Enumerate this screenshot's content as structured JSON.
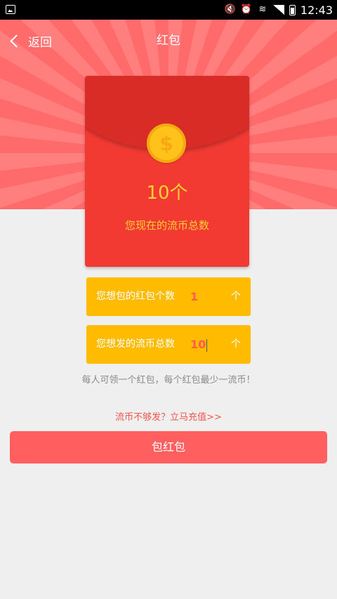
{
  "status_bar": {
    "time": "12:43",
    "icons": [
      "image-icon",
      "mute-icon",
      "alarm-icon",
      "wifi-icon",
      "signal-icon",
      "battery-icon"
    ]
  },
  "nav": {
    "back_label": "返回",
    "title": "红包"
  },
  "envelope": {
    "amount": "10个",
    "caption": "您现在的流币总数",
    "coin_symbol": "$"
  },
  "fields": {
    "count": {
      "label": "您想包的红包个数",
      "value": "1",
      "unit": "个"
    },
    "total": {
      "label": "您想发的流币总数",
      "value": "10",
      "unit": "个"
    }
  },
  "rule_text": "每人可领一个红包，每个红包最少一流币！",
  "recharge_link": "流币不够发？立马充值>>",
  "submit_label": "包红包",
  "colors": {
    "hero": "#ff6b6b",
    "envelope": "#f23a32",
    "flap": "#d92c27",
    "field": "#ffbb00",
    "accent_text": "#ffd033",
    "button": "#ff5f5f"
  }
}
